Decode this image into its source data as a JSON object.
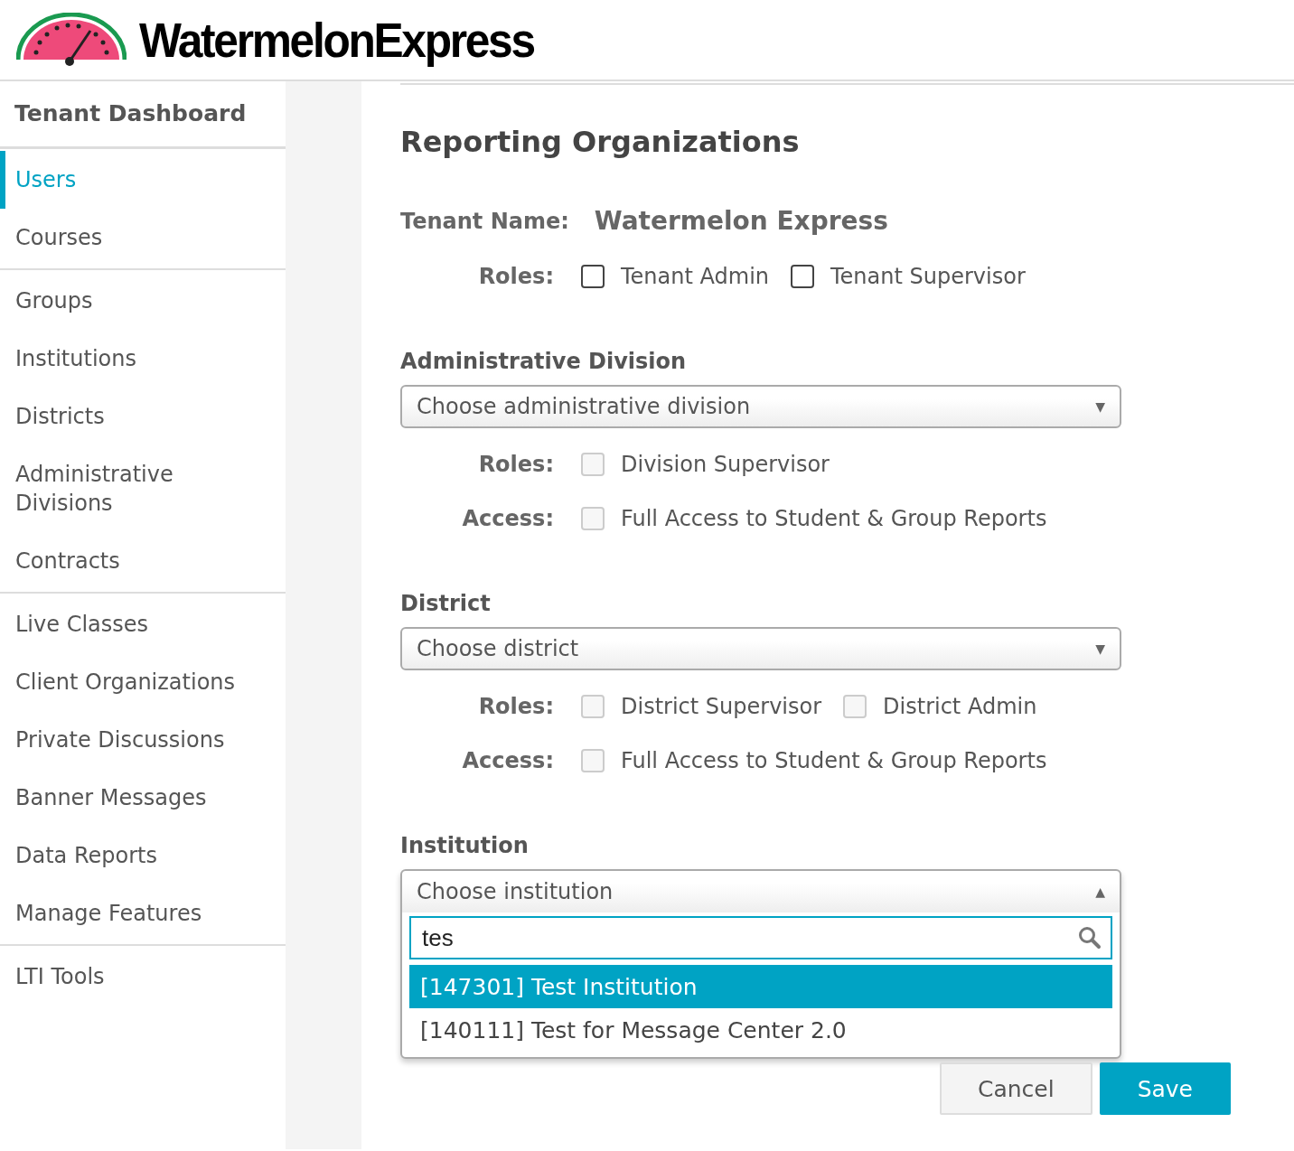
{
  "logo": {
    "text": "WatermelonExpress"
  },
  "sidebar": {
    "heading": "Tenant Dashboard",
    "groups": [
      [
        {
          "label": "Users",
          "selected": true
        },
        {
          "label": "Courses",
          "selected": false
        }
      ],
      [
        {
          "label": "Groups",
          "selected": false
        },
        {
          "label": "Institutions",
          "selected": false
        },
        {
          "label": "Districts",
          "selected": false
        },
        {
          "label": "Administrative Divisions",
          "selected": false
        },
        {
          "label": "Contracts",
          "selected": false
        }
      ],
      [
        {
          "label": "Live Classes",
          "selected": false
        },
        {
          "label": "Client Organizations",
          "selected": false
        },
        {
          "label": "Private Discussions",
          "selected": false
        },
        {
          "label": "Banner Messages",
          "selected": false
        },
        {
          "label": "Data Reports",
          "selected": false
        },
        {
          "label": "Manage Features",
          "selected": false
        }
      ],
      [
        {
          "label": "LTI Tools",
          "selected": false
        }
      ]
    ]
  },
  "page": {
    "title": "Reporting Organizations"
  },
  "tenant": {
    "label": "Tenant Name:",
    "value": "Watermelon Express",
    "rows": [
      {
        "label": "Roles:",
        "options": [
          {
            "label": "Tenant Admin",
            "checked": false,
            "disabled": false
          },
          {
            "label": "Tenant Supervisor",
            "checked": false,
            "disabled": false
          }
        ]
      }
    ]
  },
  "sections": [
    {
      "heading": "Administrative Division",
      "select": {
        "placeholder": "Choose administrative division",
        "caret": "▼",
        "expanded": false
      },
      "rows": [
        {
          "label": "Roles:",
          "options": [
            {
              "label": "Division Supervisor",
              "checked": false,
              "disabled": true
            }
          ]
        },
        {
          "label": "Access:",
          "options": [
            {
              "label": "Full Access to Student & Group Reports",
              "checked": false,
              "disabled": true
            }
          ]
        }
      ]
    },
    {
      "heading": "District",
      "select": {
        "placeholder": "Choose district",
        "caret": "▼",
        "expanded": false
      },
      "rows": [
        {
          "label": "Roles:",
          "options": [
            {
              "label": "District Supervisor",
              "checked": false,
              "disabled": true
            },
            {
              "label": "District Admin",
              "checked": false,
              "disabled": true
            }
          ]
        },
        {
          "label": "Access:",
          "options": [
            {
              "label": "Full Access to Student & Group Reports",
              "checked": false,
              "disabled": true
            }
          ]
        }
      ]
    },
    {
      "heading": "Institution",
      "select": {
        "placeholder": "Choose institution",
        "caret": "▲",
        "expanded": true,
        "search": "tes",
        "options": [
          {
            "label": "[147301] Test Institution",
            "selected": true
          },
          {
            "label": "[140111] Test for Message Center 2.0",
            "selected": false
          }
        ]
      }
    }
  ],
  "buttons": [
    {
      "label": "Cancel",
      "kind": "secondary"
    },
    {
      "label": "Save",
      "kind": "primary"
    }
  ]
}
